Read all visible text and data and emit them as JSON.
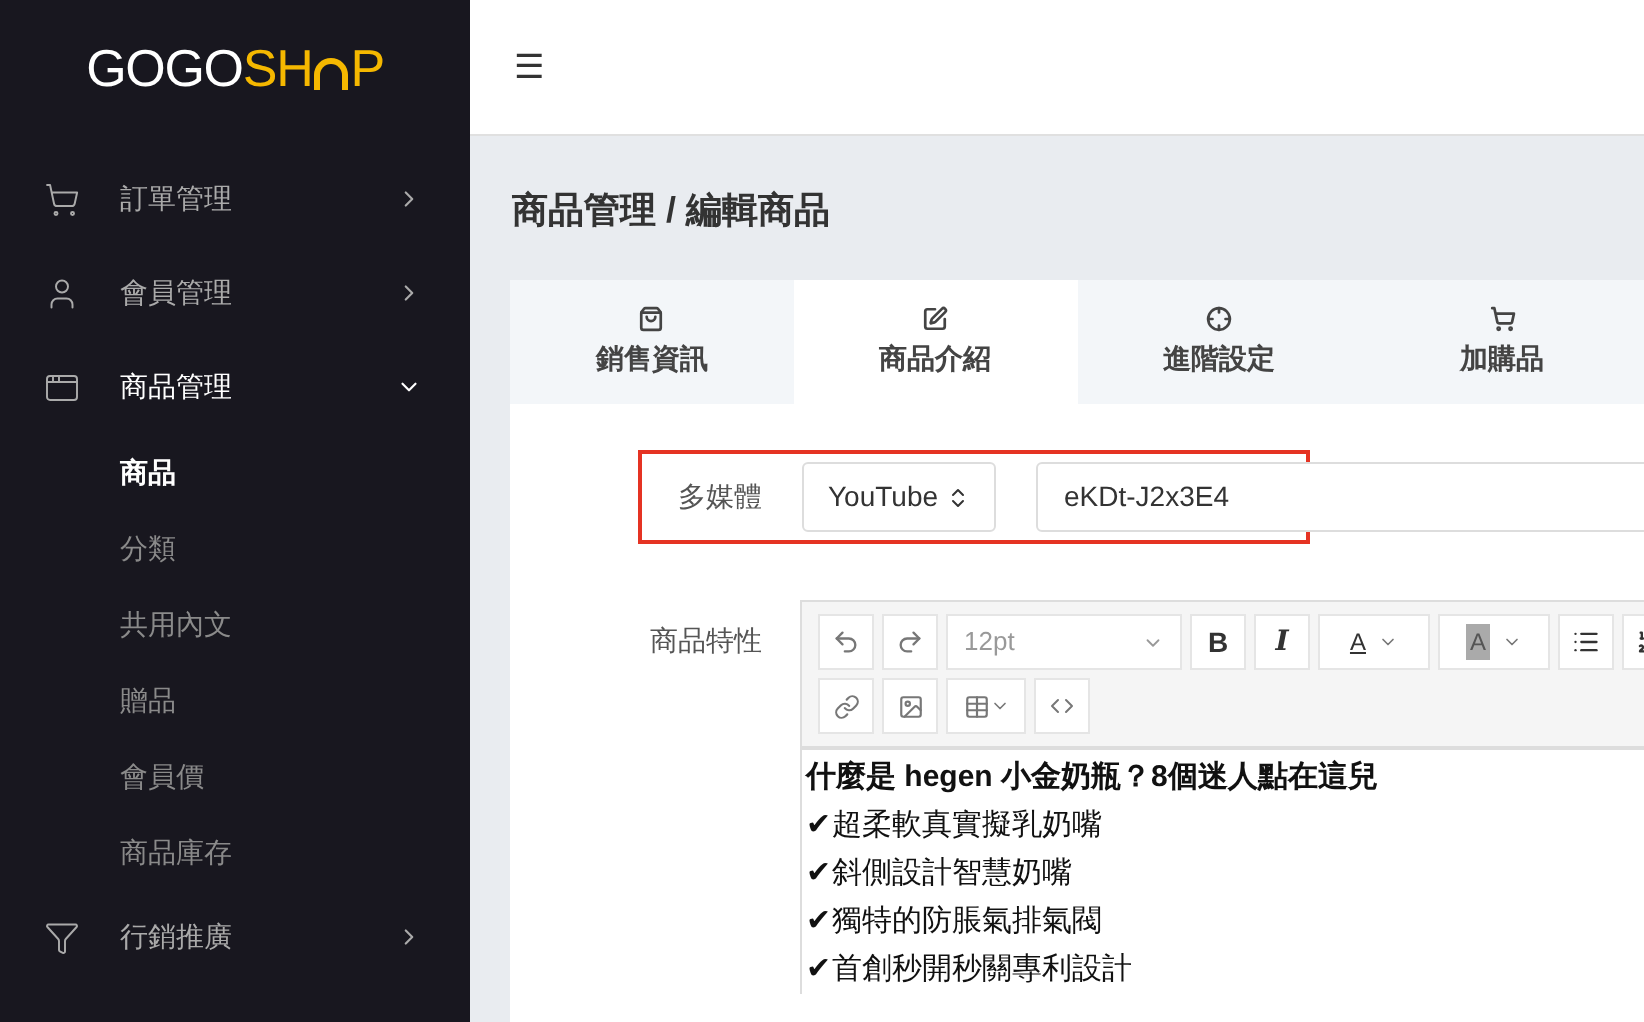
{
  "logo": {
    "first": "GOGO",
    "second": "SH",
    "third": "P"
  },
  "sidebar": {
    "items": [
      {
        "kind": "cart",
        "label": "訂單管理",
        "expanded": false
      },
      {
        "kind": "user",
        "label": "會員管理",
        "expanded": false
      },
      {
        "kind": "window",
        "label": "商品管理",
        "expanded": true,
        "children": [
          {
            "label": "商品",
            "selected": true
          },
          {
            "label": "分類",
            "selected": false
          },
          {
            "label": "共用內文",
            "selected": false
          },
          {
            "label": "贈品",
            "selected": false
          },
          {
            "label": "會員價",
            "selected": false
          },
          {
            "label": "商品庫存",
            "selected": false
          }
        ]
      },
      {
        "kind": "filter",
        "label": "行銷推廣",
        "expanded": false
      }
    ]
  },
  "topbar": {
    "menu": "☰"
  },
  "page_title": "商品管理 / 編輯商品",
  "tabs": [
    {
      "kind": "bag",
      "label": "銷售資訊",
      "selected": false
    },
    {
      "kind": "edit",
      "label": "商品介紹",
      "selected": true
    },
    {
      "kind": "target",
      "label": "進階設定",
      "selected": false
    },
    {
      "kind": "cart",
      "label": "加購品",
      "selected": false
    }
  ],
  "media": {
    "label": "多媒體",
    "select": "YouTube",
    "value": "eKDt-J2x3E4"
  },
  "features": {
    "label": "商品特性",
    "toolbar": {
      "font_size": "12pt",
      "bold": "B",
      "italic": "I",
      "text_color": "A",
      "bg_color": "A"
    },
    "lines": [
      "什麼是 hegen 小金奶瓶？8個迷人點在這兒",
      "✔超柔軟真實擬乳奶嘴",
      "✔斜側設計智慧奶嘴",
      "✔獨特的防脹氣排氣閥",
      "✔首創秒開秒關專利設計"
    ]
  }
}
